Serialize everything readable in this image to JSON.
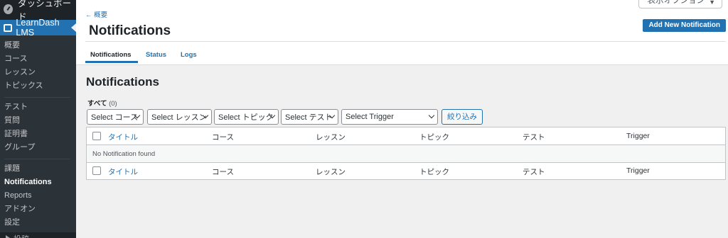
{
  "sidebar": {
    "dashboard_label": "ダッシュボード",
    "active_label": "LearnDash LMS",
    "items": [
      {
        "label": "概要"
      },
      {
        "label": "コース"
      },
      {
        "label": "レッスン"
      },
      {
        "label": "トピックス"
      },
      {
        "label": "テスト"
      },
      {
        "label": "質問"
      },
      {
        "label": "証明書"
      },
      {
        "label": "グループ"
      },
      {
        "label": "課題"
      },
      {
        "label": "Notifications"
      },
      {
        "label": "Reports"
      },
      {
        "label": "アドオン"
      },
      {
        "label": "設定"
      }
    ],
    "bottom_label": "投稿"
  },
  "header": {
    "screen_options": "表示オプション",
    "back_link": "← 概要",
    "title": "Notifications",
    "add_button": "Add New Notification",
    "tabs": [
      {
        "label": "Notifications",
        "active": true
      },
      {
        "label": "Status",
        "active": false
      },
      {
        "label": "Logs",
        "active": false
      }
    ]
  },
  "main": {
    "title": "Notifications",
    "filter_all": "すべて",
    "filter_count": "(0)",
    "filters": [
      {
        "label": "Select コース"
      },
      {
        "label": "Select レッスン"
      },
      {
        "label": "Select トピック"
      },
      {
        "label": "Select テスト"
      },
      {
        "label": "Select Trigger"
      }
    ],
    "filter_button": "絞り込み",
    "table": {
      "columns": [
        "タイトル",
        "コース",
        "レッスン",
        "トピック",
        "テスト",
        "Trigger"
      ],
      "empty_message": "No Notification found"
    }
  },
  "colors": {
    "accent": "#2271b1",
    "sidebar_bg": "#1d2327",
    "submenu_bg": "#2c3338"
  }
}
